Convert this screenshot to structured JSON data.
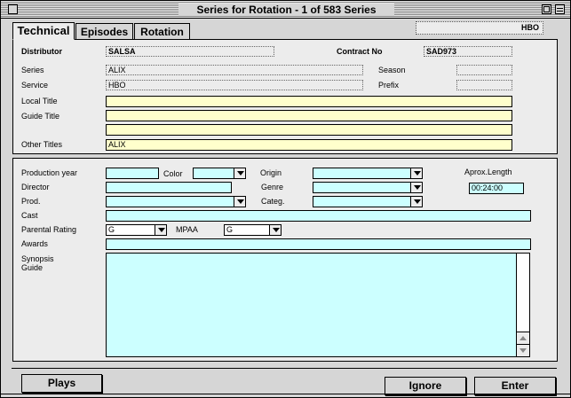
{
  "window": {
    "title": "Series for Rotation - 1 of 583 Series"
  },
  "tabs": [
    {
      "label": "Technical",
      "active": true
    },
    {
      "label": "Episodes",
      "active": false
    },
    {
      "label": "Rotation",
      "active": false
    }
  ],
  "header_badge": "HBO",
  "top_section": {
    "distributor_label": "Distributor",
    "distributor_value": "SALSA",
    "contract_label": "Contract No",
    "contract_value": "SAD973",
    "series_label": "Series",
    "series_value": "ALIX",
    "season_label": "Season",
    "season_value": "",
    "service_label": "Service",
    "service_value": "HBO",
    "prefix_label": "Prefix",
    "prefix_value": "",
    "local_title_label": "Local Title",
    "local_title_value": "",
    "guide_title_label": "Guide Title",
    "guide_title_value": "",
    "guide_title2_value": "",
    "other_titles_label": "Other Titles",
    "other_titles_value": "ALIX"
  },
  "technical": {
    "production_year_label": "Production year",
    "production_year_value": "",
    "color_label": "Color",
    "color_value": "",
    "origin_label": "Origin",
    "origin_value": "",
    "aprox_length_label": "Aprox.Length",
    "aprox_length_value": "00:24:00",
    "director_label": "Director",
    "director_value": "",
    "genre_label": "Genre",
    "genre_value": "",
    "prod_label": "Prod.",
    "prod_value": "",
    "categ_label": "Categ.",
    "categ_value": "",
    "cast_label": "Cast",
    "cast_value": "",
    "parental_rating_label": "Parental Rating",
    "parental_rating_value": "G",
    "mpaa_label": "MPAA",
    "mpaa_value": "G",
    "awards_label": "Awards",
    "awards_value": "",
    "synopsis_label": "Synopsis",
    "guide_label": "Guide",
    "synopsis_value": ""
  },
  "buttons": {
    "plays": "Plays",
    "ignore": "Ignore",
    "enter": "Enter"
  }
}
